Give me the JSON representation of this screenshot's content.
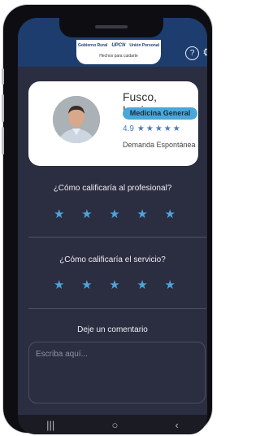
{
  "header": {
    "logos": [
      "Gobierno Rural",
      "UPCN",
      "Unión Personal"
    ],
    "tagline": "Hechos para cuidarte",
    "help_icon": "question-circle-icon",
    "settings_icon": "gear-icon"
  },
  "doctor": {
    "name": "Fusco, Luciano",
    "specialty": "Medicina General",
    "rating": "4.9",
    "stars": "★★★★★",
    "care_type": "Demanda Espontánea"
  },
  "rating_professional": {
    "question": "¿Cómo calificaría al profesional?",
    "stars": 5
  },
  "rating_service": {
    "question": "¿Cómo calificaría el servicio?",
    "stars": 5
  },
  "comment": {
    "label": "Deje un comentario",
    "placeholder": "Escriba aquí..."
  },
  "navbar": {
    "recents": "|||",
    "home": "○",
    "back": "‹"
  },
  "colors": {
    "accent": "#4da3dc",
    "header": "#1d3d6e",
    "background": "#2b2d40"
  }
}
